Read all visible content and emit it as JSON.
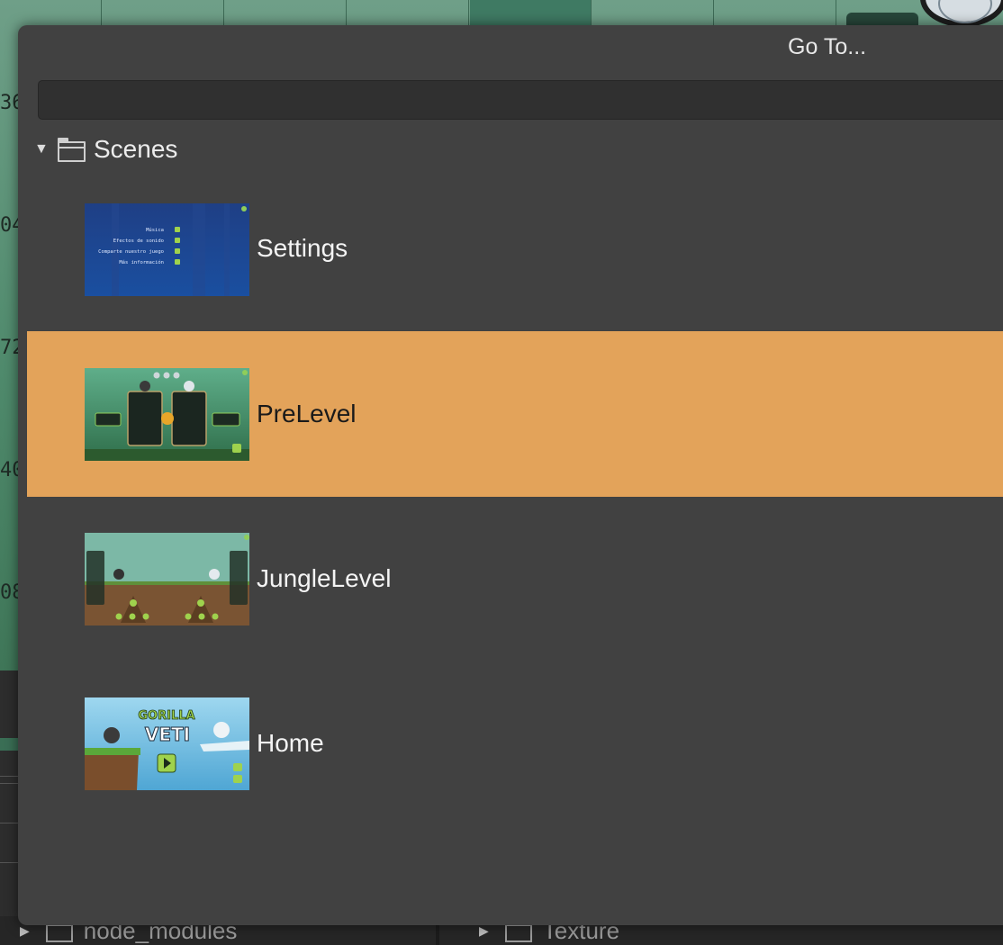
{
  "background": {
    "ruler_numbers": [
      "36",
      "04",
      "72",
      "40",
      "08"
    ],
    "left_tree_item": "node_modules",
    "right_tree_item": "Texture"
  },
  "dialog": {
    "title": "Go To...",
    "search": {
      "value": "",
      "placeholder": ""
    },
    "folder": {
      "label": "Scenes",
      "expanded": true
    },
    "scenes": [
      {
        "label": "Settings",
        "selected": false,
        "thumbnail": "settings-thumbnail"
      },
      {
        "label": "PreLevel",
        "selected": true,
        "thumbnail": "prelevel-thumbnail"
      },
      {
        "label": "JungleLevel",
        "selected": false,
        "thumbnail": "junglelevel-thumbnail"
      },
      {
        "label": "Home",
        "selected": false,
        "thumbnail": "home-thumbnail"
      }
    ],
    "colors": {
      "dialog_bg": "#414141",
      "selected_row": "#e3a35a",
      "text": "#f4f4f4"
    },
    "thumbnail_text": {
      "settings_menu": [
        "Música",
        "Efectos de sonido",
        "Comparte nuestro juego",
        "Más información"
      ],
      "home_logo": [
        "GORILLA",
        "VETI"
      ]
    }
  }
}
